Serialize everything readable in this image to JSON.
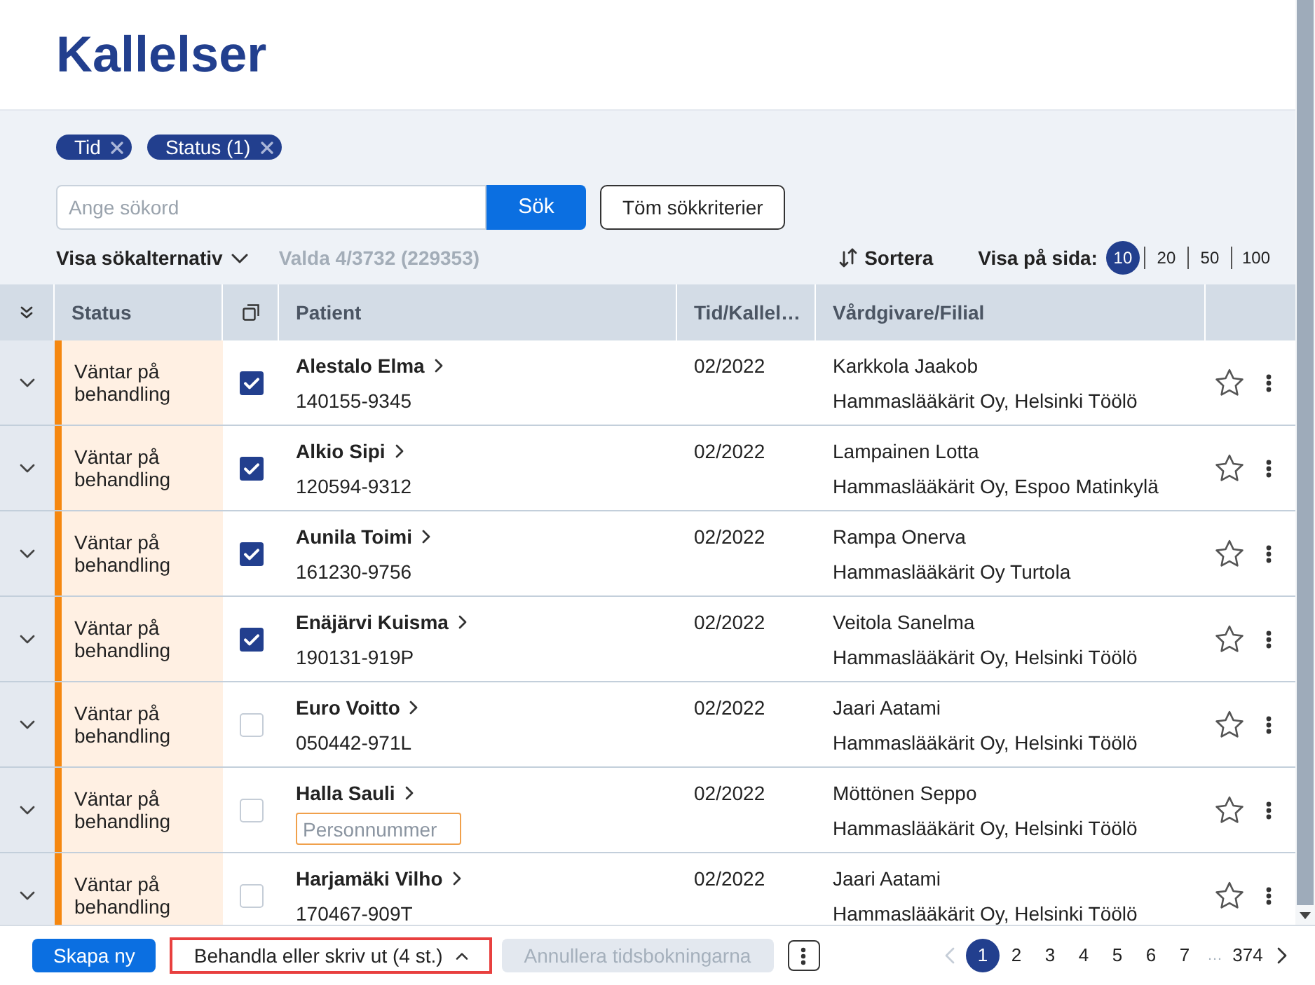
{
  "page": {
    "title": "Kallelser"
  },
  "filters": {
    "chips": [
      {
        "label": "Tid"
      },
      {
        "label": "Status (1)"
      }
    ],
    "search_placeholder": "Ange sökord",
    "search_button": "Sök",
    "clear_button": "Töm sökkriterier",
    "options_toggle": {
      "label": "Visa sökalternativ",
      "expanded": false
    },
    "selection_summary": "Valda 4/3732 (229353)",
    "sort_button": "Sortera",
    "page_size_label": "Visa på sida:",
    "page_size_options": [
      {
        "label": "10",
        "selected": true
      },
      {
        "label": "20",
        "selected": false
      },
      {
        "label": "50",
        "selected": false
      },
      {
        "label": "100",
        "selected": false
      }
    ]
  },
  "table": {
    "columns": [
      "Status",
      "Patient",
      "Tid/Kallel…",
      "Vårdgivare/Filial"
    ],
    "rows": [
      {
        "expanded": false,
        "status": "Väntar på behandling",
        "selected": true,
        "name": "Alestalo Elma",
        "personal_id": {
          "kind": "text",
          "value": "140155-9345"
        },
        "time": "02/2022",
        "caregiver": "Karkkola Jaakob",
        "clinic": "Hammaslääkärit Oy, Helsinki Töölö",
        "starred": false
      },
      {
        "expanded": false,
        "status": "Väntar på behandling",
        "selected": true,
        "name": "Alkio Sipi",
        "personal_id": {
          "kind": "text",
          "value": "120594-9312"
        },
        "time": "02/2022",
        "caregiver": "Lampainen Lotta",
        "clinic": "Hammaslääkärit Oy, Espoo Matinkylä",
        "starred": false
      },
      {
        "expanded": false,
        "status": "Väntar på behandling",
        "selected": true,
        "name": "Aunila Toimi",
        "personal_id": {
          "kind": "text",
          "value": "161230-9756"
        },
        "time": "02/2022",
        "caregiver": "Rampa Onerva",
        "clinic": "Hammaslääkärit Oy Turtola",
        "starred": false
      },
      {
        "expanded": false,
        "status": "Väntar på behandling",
        "selected": true,
        "name": "Enäjärvi Kuisma",
        "personal_id": {
          "kind": "text",
          "value": "190131-919P"
        },
        "time": "02/2022",
        "caregiver": "Veitola Sanelma",
        "clinic": "Hammaslääkärit Oy, Helsinki Töölö",
        "starred": false
      },
      {
        "expanded": false,
        "status": "Väntar på behandling",
        "selected": false,
        "name": "Euro Voitto",
        "personal_id": {
          "kind": "text",
          "value": "050442-971L"
        },
        "time": "02/2022",
        "caregiver": "Jaari Aatami",
        "clinic": "Hammaslääkärit Oy, Helsinki Töölö",
        "starred": false
      },
      {
        "expanded": false,
        "status": "Väntar på behandling",
        "selected": false,
        "name": "Halla Sauli",
        "personal_id": {
          "kind": "field",
          "placeholder": "Personnummer"
        },
        "time": "02/2022",
        "caregiver": "Möttönen Seppo",
        "clinic": "Hammaslääkärit Oy, Helsinki Töölö",
        "starred": false
      },
      {
        "expanded": false,
        "status": "Väntar på behandling",
        "selected": false,
        "name": "Harjamäki Vilho",
        "personal_id": {
          "kind": "text",
          "value": "170467-909T"
        },
        "time": "02/2022",
        "caregiver": "Jaari Aatami",
        "clinic": "Hammaslääkärit Oy, Helsinki Töölö",
        "starred": false
      }
    ]
  },
  "bottom_bar": {
    "create_button": "Skapa ny",
    "process_button": {
      "label": "Behandla eller skriv ut (4 st.)",
      "highlighted": true
    },
    "cancel_button": {
      "label": "Annullera tidsbokningarna",
      "disabled": true
    }
  },
  "pagination": {
    "previous_disabled": true,
    "next_disabled": false,
    "pages": [
      {
        "label": "1",
        "selected": true
      },
      {
        "label": "2",
        "selected": false
      },
      {
        "label": "3",
        "selected": false
      },
      {
        "label": "4",
        "selected": false
      },
      {
        "label": "5",
        "selected": false
      },
      {
        "label": "6",
        "selected": false
      },
      {
        "label": "7",
        "selected": false
      }
    ],
    "gap": "…",
    "last_page": {
      "label": "374",
      "selected": false
    }
  }
}
